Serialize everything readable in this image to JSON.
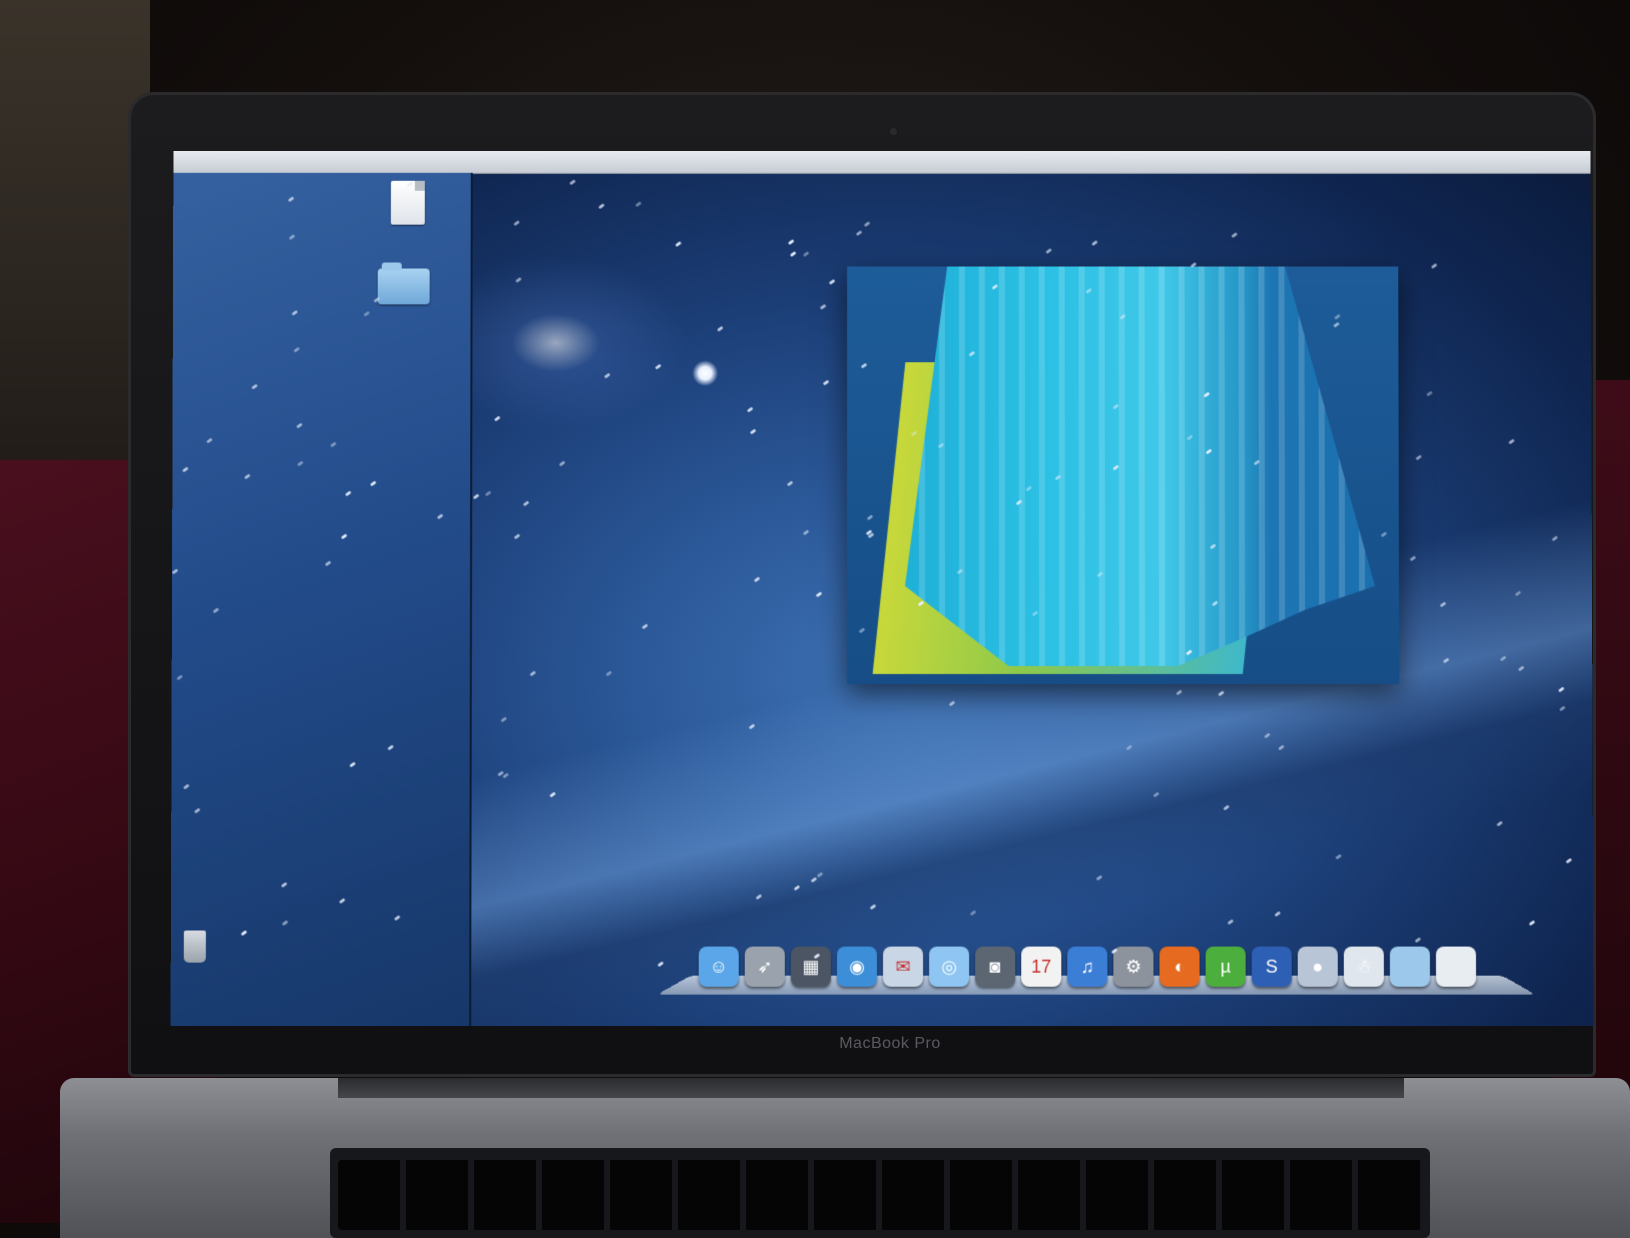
{
  "device": {
    "brand_label": "MacBook Pro"
  },
  "menubar": {
    "left_text": "",
    "apps_text": "",
    "right_text": ""
  },
  "desktop_icons": [
    {
      "name": "file",
      "label": "",
      "icon": "document-icon"
    },
    {
      "name": "folder",
      "label": "",
      "icon": "folder-icon"
    }
  ],
  "preview_window": {
    "badge": ""
  },
  "dock": {
    "items": [
      {
        "name": "finder",
        "icon": "finder-icon",
        "color": "#5aa6e8",
        "glyph": "☺"
      },
      {
        "name": "launchpad",
        "icon": "rocket-icon",
        "color": "#9aa3ad",
        "glyph": "➶"
      },
      {
        "name": "mission-control",
        "icon": "mission-control-icon",
        "color": "#4b5563",
        "glyph": "▦"
      },
      {
        "name": "app-store-like",
        "icon": "globe-icon",
        "color": "#3d8ed8",
        "glyph": "◉"
      },
      {
        "name": "mail",
        "icon": "stamp-icon",
        "color": "#c9d6e6",
        "glyph": "✉"
      },
      {
        "name": "safari",
        "icon": "compass-icon",
        "color": "#8ec5f2",
        "glyph": "◎"
      },
      {
        "name": "facetime",
        "icon": "camera-icon",
        "color": "#5c6673",
        "glyph": "◙"
      },
      {
        "name": "calendar",
        "icon": "calendar-icon",
        "color": "#f2f2f2",
        "glyph": "17"
      },
      {
        "name": "itunes",
        "icon": "music-icon",
        "color": "#3b7ed6",
        "glyph": "♫"
      },
      {
        "name": "system-preferences",
        "icon": "gear-icon",
        "color": "#8c939c",
        "glyph": "⚙"
      },
      {
        "name": "firefox",
        "icon": "firefox-icon",
        "color": "#e66a1f",
        "glyph": "◐"
      },
      {
        "name": "utorrent",
        "icon": "torrent-icon",
        "color": "#4cae3d",
        "glyph": "µ"
      },
      {
        "name": "photoshop-like",
        "icon": "app-icon",
        "color": "#2d5fb4",
        "glyph": "S"
      },
      {
        "name": "app-1",
        "icon": "disc-icon",
        "color": "#b7c5d6",
        "glyph": "●"
      },
      {
        "name": "app-2",
        "icon": "penguin-icon",
        "color": "#dfe6ee",
        "glyph": "☃"
      },
      {
        "name": "downloads",
        "icon": "folder-icon",
        "color": "#9cc8ec",
        "glyph": ""
      },
      {
        "name": "documents",
        "icon": "document-icon",
        "color": "#e8edf2",
        "glyph": ""
      }
    ]
  },
  "trash": {
    "icon": "trash-icon"
  }
}
